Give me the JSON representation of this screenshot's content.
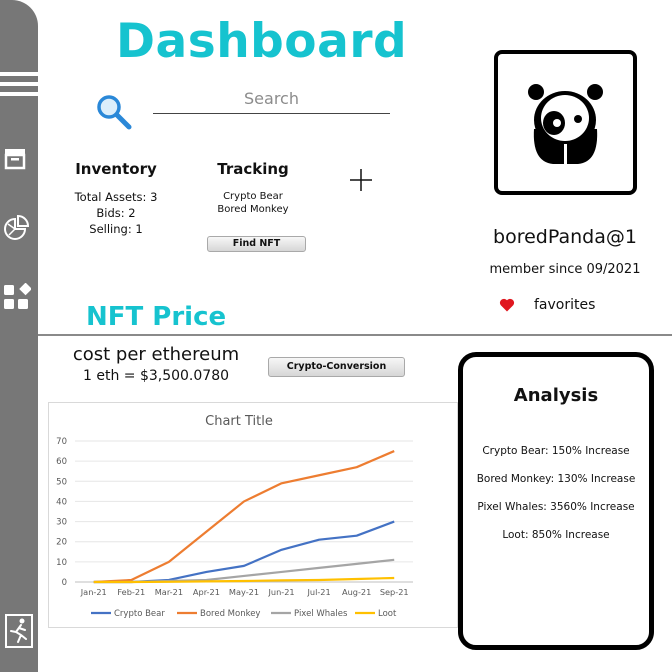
{
  "header": {
    "title": "Dashboard"
  },
  "search": {
    "placeholder": "Search"
  },
  "sidebar": {
    "icons": [
      "menu-icon",
      "archive-icon",
      "pie-chart-icon",
      "apps-grid-icon",
      "exit-icon"
    ]
  },
  "inventory": {
    "title": "Inventory",
    "lines": [
      "Total Assets: 3",
      "Bids: 2",
      "Selling: 1"
    ]
  },
  "tracking": {
    "title": "Tracking",
    "items": [
      "Crypto Bear",
      "Bored Monkey"
    ],
    "button_label": "Find NFT"
  },
  "profile": {
    "username": "boredPanda@1",
    "member_since": "member since 09/2021",
    "favorites_label": "favorites"
  },
  "nft_price": {
    "section_title": "NFT Price",
    "cost_label": "cost per ethereum",
    "rate": "1 eth = $3,500.0780",
    "conversion_button": "Crypto-Conversion"
  },
  "chart_data": {
    "type": "line",
    "title": "Chart Title",
    "x": [
      "Jan-21",
      "Feb-21",
      "Mar-21",
      "Apr-21",
      "May-21",
      "Jun-21",
      "Jul-21",
      "Aug-21",
      "Sep-21"
    ],
    "ylim": [
      0,
      70
    ],
    "yticks": [
      0,
      10,
      20,
      30,
      40,
      50,
      60,
      70
    ],
    "grid": true,
    "legend": "bottom",
    "series": [
      {
        "name": "Crypto Bear",
        "color": "#4472c4",
        "values": [
          0,
          0,
          1,
          5,
          8,
          16,
          21,
          23,
          30
        ]
      },
      {
        "name": "Bored Monkey",
        "color": "#ed7d31",
        "values": [
          0,
          1,
          10,
          25,
          40,
          49,
          53,
          57,
          65
        ]
      },
      {
        "name": "Pixel Whales",
        "color": "#a5a5a5",
        "values": [
          0,
          0,
          0.5,
          1,
          3,
          5,
          7,
          9,
          11
        ]
      },
      {
        "name": "Loot",
        "color": "#ffc000",
        "values": [
          0,
          0,
          0.1,
          0.3,
          0.5,
          0.8,
          1,
          1.5,
          2
        ]
      }
    ]
  },
  "analysis": {
    "title": "Analysis",
    "items": [
      "Crypto Bear: 150% Increase",
      "Bored Monkey: 130% Increase",
      "Pixel Whales:  3560% Increase",
      "Loot: 850% Increase"
    ]
  },
  "colors": {
    "accent": "#16c3cf",
    "sidebar": "#777777",
    "heart": "#e0171f"
  }
}
